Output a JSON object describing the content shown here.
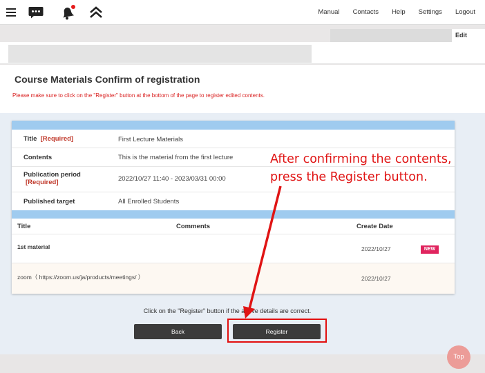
{
  "nav": {
    "links": [
      "Manual",
      "Contacts",
      "Help",
      "Settings",
      "Logout"
    ]
  },
  "edit_label": "Edit",
  "page": {
    "title": "Course Materials Confirm of registration",
    "notice": "Please make sure to click on the \"Register\" button at the bottom of the page to register edited contents."
  },
  "details": {
    "title_label": "Title",
    "required": "[Required]",
    "title_value": "First Lecture Materials",
    "contents_label": "Contents",
    "contents_value": "This is the material from the first lecture",
    "period_label": "Publication period",
    "period_value": "2022/10/27 11:40 - 2023/03/31 00:00",
    "target_label": "Published target",
    "target_value": "All Enrolled Students"
  },
  "table": {
    "headers": [
      "Title",
      "Comments",
      "Create Date"
    ],
    "rows": [
      {
        "title": "1st material",
        "date": "2022/10/27",
        "badge": "NEW"
      },
      {
        "title": "zoom（ https://zoom.us/ja/products/meetings/ ）",
        "date": "2022/10/27"
      }
    ]
  },
  "confirm_text": "Click on the \"Register\" button if the above details are correct.",
  "buttons": {
    "back": "Back",
    "register": "Register"
  },
  "annotation": {
    "line1": "After confirming the contents,",
    "line2": "press the Register button."
  },
  "top_button": "Top",
  "colors": {
    "annotation": "#e01414",
    "accent_blue": "#9fcbef",
    "badge": "#e0245e",
    "button": "#3b3b3b"
  },
  "icons": [
    "hamburger-menu-icon",
    "chat-bubble-icon",
    "bell-notification-icon",
    "double-chevron-up-icon"
  ]
}
